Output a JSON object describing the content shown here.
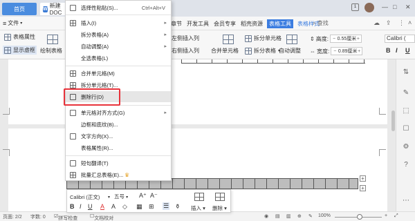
{
  "titlebar": {
    "home_tab": "首页",
    "doc_tab": "新建 DOC",
    "badge": "1"
  },
  "menurow": {
    "file_label": "文件",
    "tabs": [
      "章节",
      "开发工具",
      "会员专享",
      "稻壳资源",
      "表格工具",
      "表格样式"
    ],
    "search_label": "查找"
  },
  "ribbon": {
    "table_props": "表格属性",
    "show_grid": "显示虚框",
    "draw_table": "绘制表格",
    "insert_col_left": "左侧插入列",
    "insert_col_right": "右侧插入列",
    "merge_cells": "合并单元格",
    "split_cells": "拆分单元格",
    "split_table": "拆分表格",
    "auto_fit": "自动调整",
    "height_label": "高度:",
    "height_value": "0.55厘米",
    "width_label": "宽度:",
    "width_value": "0.89厘米",
    "font": "Calibri (",
    "bold": "B",
    "italic": "I",
    "underline": "U"
  },
  "context_menu": {
    "items": [
      {
        "label": "选择性粘贴(S)...",
        "shortcut": "Ctrl+Alt+V",
        "icon": "paste-icon"
      },
      {
        "label": "插入(I)",
        "submenu": true,
        "icon": "insert-table-icon"
      },
      {
        "label": "拆分表格(A)",
        "submenu": true
      },
      {
        "label": "自动调整(A)",
        "submenu": true
      },
      {
        "label": "全选表格(L)"
      },
      {
        "label": "合并单元格(M)",
        "icon": "merge-cells-icon"
      },
      {
        "label": "拆分单元格(T)...",
        "icon": "split-cells-icon"
      },
      {
        "label": "删除行(D)",
        "icon": "delete-row-icon",
        "highlighted": true
      },
      {
        "label": "单元格对齐方式(G)",
        "submenu": true,
        "icon": "cell-align-icon"
      },
      {
        "label": "边框和底纹(B)..."
      },
      {
        "label": "文字方向(X)...",
        "icon": "text-direction-icon"
      },
      {
        "label": "表格属性(R)..."
      },
      {
        "label": "短句翻译(T)",
        "icon": "translate-icon"
      },
      {
        "label": "批量汇总表格(E)...",
        "icon": "batch-summary-icon",
        "premium": true
      }
    ]
  },
  "mini_toolbar": {
    "font": "Calibri (正文)",
    "font_size": "五号",
    "insert_label": "插入",
    "delete_label": "删除"
  },
  "statusbar": {
    "page": "页面: 2/2",
    "words": "字数: 0",
    "spell": "拼写检查",
    "proofread": "文档校对",
    "zoom": "100%"
  },
  "colors": {
    "accent": "#3c7de0",
    "highlight_box": "#e8323a",
    "title_bg": "#dfe3ea"
  }
}
